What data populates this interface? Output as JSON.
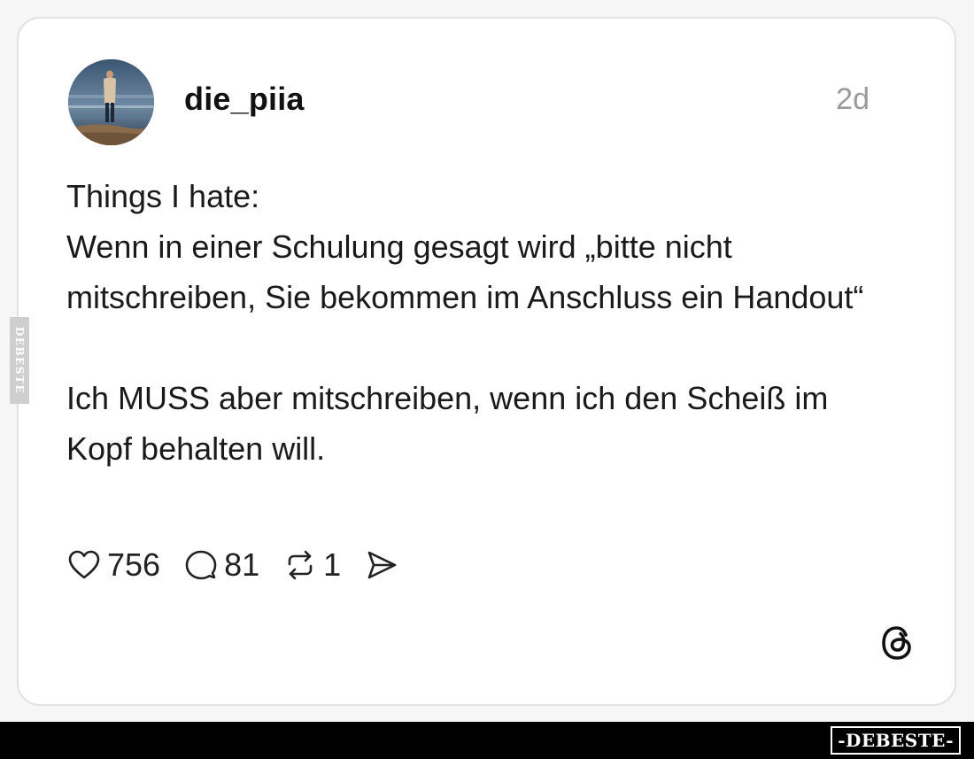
{
  "post": {
    "username": "die_piia",
    "timestamp": "2d",
    "text": "Things I hate:\nWenn in einer Schulung gesagt wird „bitte nicht mitschreiben, Sie bekommen im Anschluss ein Handout“\n\nIch MUSS aber mitschreiben, wenn ich den Scheiß im Kopf behalten will."
  },
  "actions": {
    "likes": "756",
    "comments": "81",
    "reposts": "1"
  },
  "icons": {
    "like": "heart-icon",
    "comment": "comment-bubble-icon",
    "repost": "repost-icon",
    "share": "share-send-icon",
    "brand": "threads-logo-icon"
  },
  "watermark": {
    "side": "DEBESTE",
    "bottom": "-DEBESTE-"
  },
  "colors": {
    "text": "#111111",
    "muted": "#9a9a9a",
    "card_border": "#e2e2e2",
    "footer": "#000000"
  }
}
